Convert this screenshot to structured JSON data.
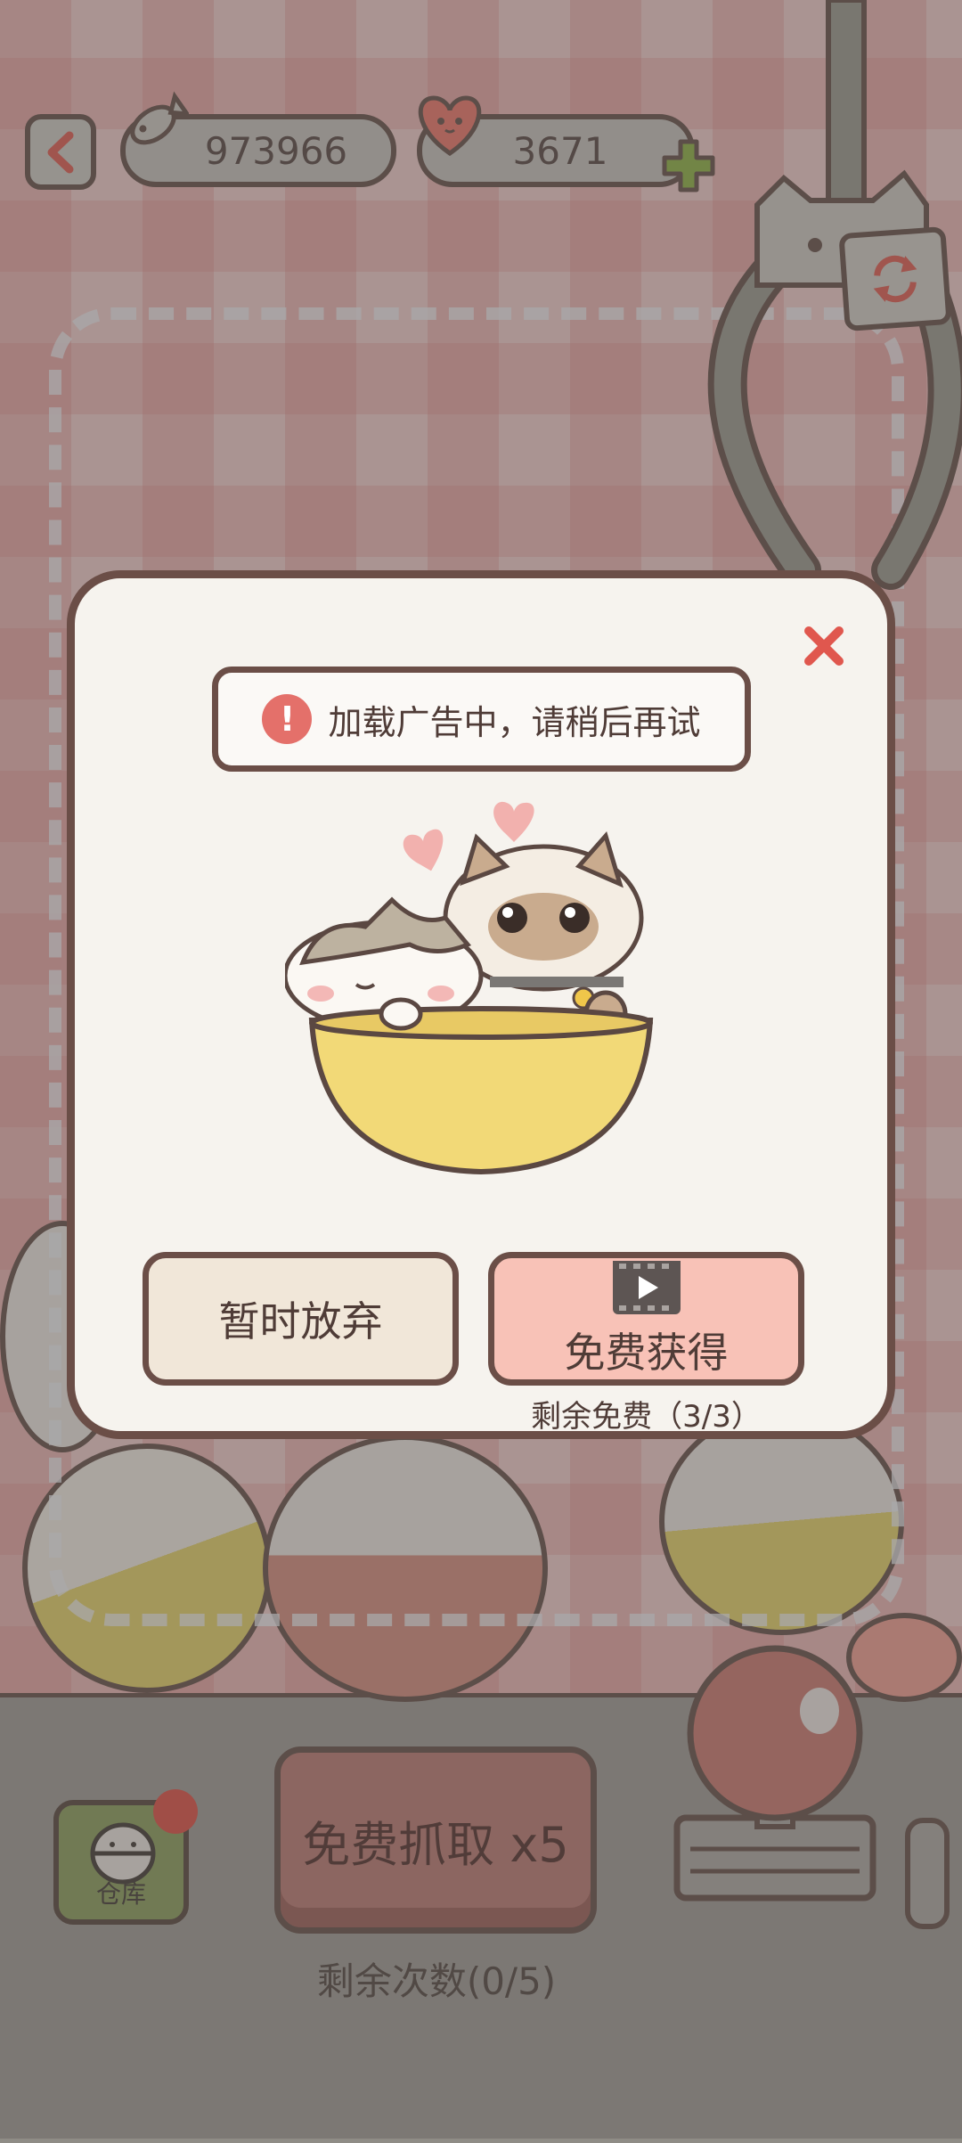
{
  "hud": {
    "fish_count": "973966",
    "heart_count": "3671",
    "fish_icon": "fish-icon",
    "heart_icon": "heart-face-icon",
    "add_icon": "plus-icon"
  },
  "modal": {
    "toast_text": "加载广告中，请稍后再试",
    "giveup_label": "暂时放弃",
    "free_label": "免费获得",
    "free_remaining": "剩余免费（3/3）",
    "video_icon": "video-icon",
    "close_icon": "close-icon"
  },
  "bottom": {
    "warehouse_label": "仓库",
    "grab_label": "免费抓取 x5",
    "remaining_count": "剩余次数(0/5)"
  },
  "colors": {
    "accent_red": "#e4706a",
    "outline": "#5b4842",
    "button_pink": "#f8c2b7",
    "button_cream": "#f1e7d9"
  }
}
